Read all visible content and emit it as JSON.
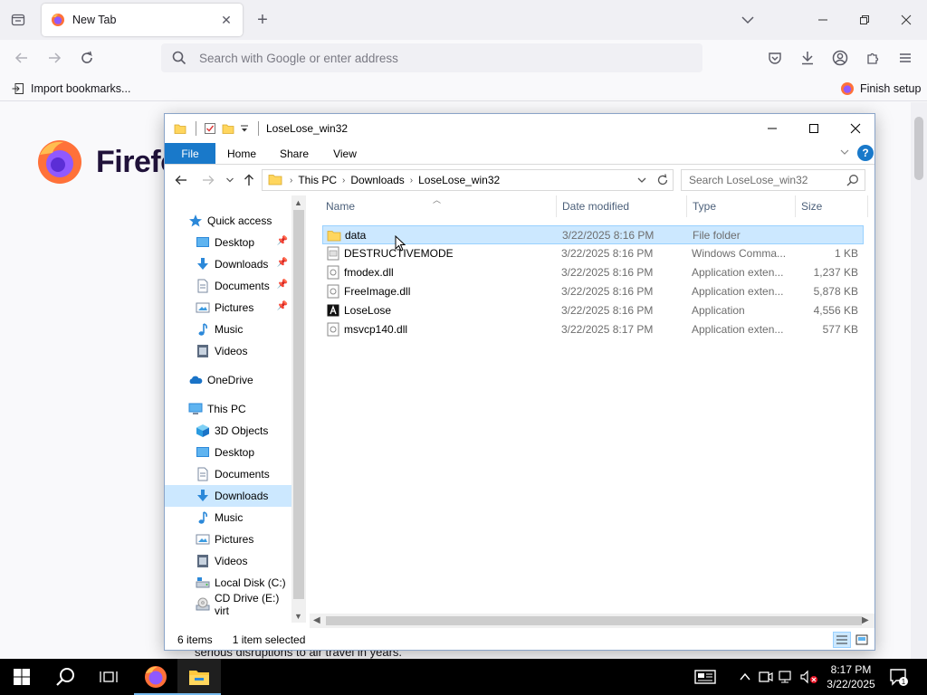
{
  "browser": {
    "tab_title": "New Tab",
    "url_placeholder": "Search with Google or enter address",
    "bookmarks": {
      "import_label": "Import bookmarks...",
      "finish_label": "Finish setup"
    },
    "logo_word": "Firefo",
    "news_snippet": "serious disruptions to air travel in years."
  },
  "explorer": {
    "title": "LoseLose_win32",
    "ribbon_tabs": [
      "File",
      "Home",
      "Share",
      "View"
    ],
    "breadcrumb": [
      "This PC",
      "Downloads",
      "LoseLose_win32"
    ],
    "search_placeholder": "Search LoseLose_win32",
    "nav": {
      "quick_access": "Quick access",
      "qa_items": [
        "Desktop",
        "Downloads",
        "Documents",
        "Pictures",
        "Music",
        "Videos"
      ],
      "onedrive": "OneDrive",
      "this_pc": "This PC",
      "pc_items": [
        "3D Objects",
        "Desktop",
        "Documents",
        "Downloads",
        "Music",
        "Pictures",
        "Videos",
        "Local Disk (C:)",
        "CD Drive (E:) virt"
      ]
    },
    "columns": {
      "name": "Name",
      "date": "Date modified",
      "type": "Type",
      "size": "Size"
    },
    "files": [
      {
        "name": "data",
        "date": "3/22/2025 8:16 PM",
        "type": "File folder",
        "size": "",
        "icon": "folder-icon"
      },
      {
        "name": "DESTRUCTIVEMODE",
        "date": "3/22/2025 8:16 PM",
        "type": "Windows Comma...",
        "size": "1 KB",
        "icon": "cmd-file-icon"
      },
      {
        "name": "fmodex.dll",
        "date": "3/22/2025 8:16 PM",
        "type": "Application exten...",
        "size": "1,237 KB",
        "icon": "dll-file-icon"
      },
      {
        "name": "FreeImage.dll",
        "date": "3/22/2025 8:16 PM",
        "type": "Application exten...",
        "size": "5,878 KB",
        "icon": "dll-file-icon"
      },
      {
        "name": "LoseLose",
        "date": "3/22/2025 8:16 PM",
        "type": "Application",
        "size": "4,556 KB",
        "icon": "app-icon"
      },
      {
        "name": "msvcp140.dll",
        "date": "3/22/2025 8:17 PM",
        "type": "Application exten...",
        "size": "577 KB",
        "icon": "dll-file-icon"
      }
    ],
    "status": {
      "items": "6 items",
      "selected": "1 item selected"
    }
  },
  "taskbar": {
    "time": "8:17 PM",
    "date": "3/22/2025",
    "notif_count": "1"
  }
}
